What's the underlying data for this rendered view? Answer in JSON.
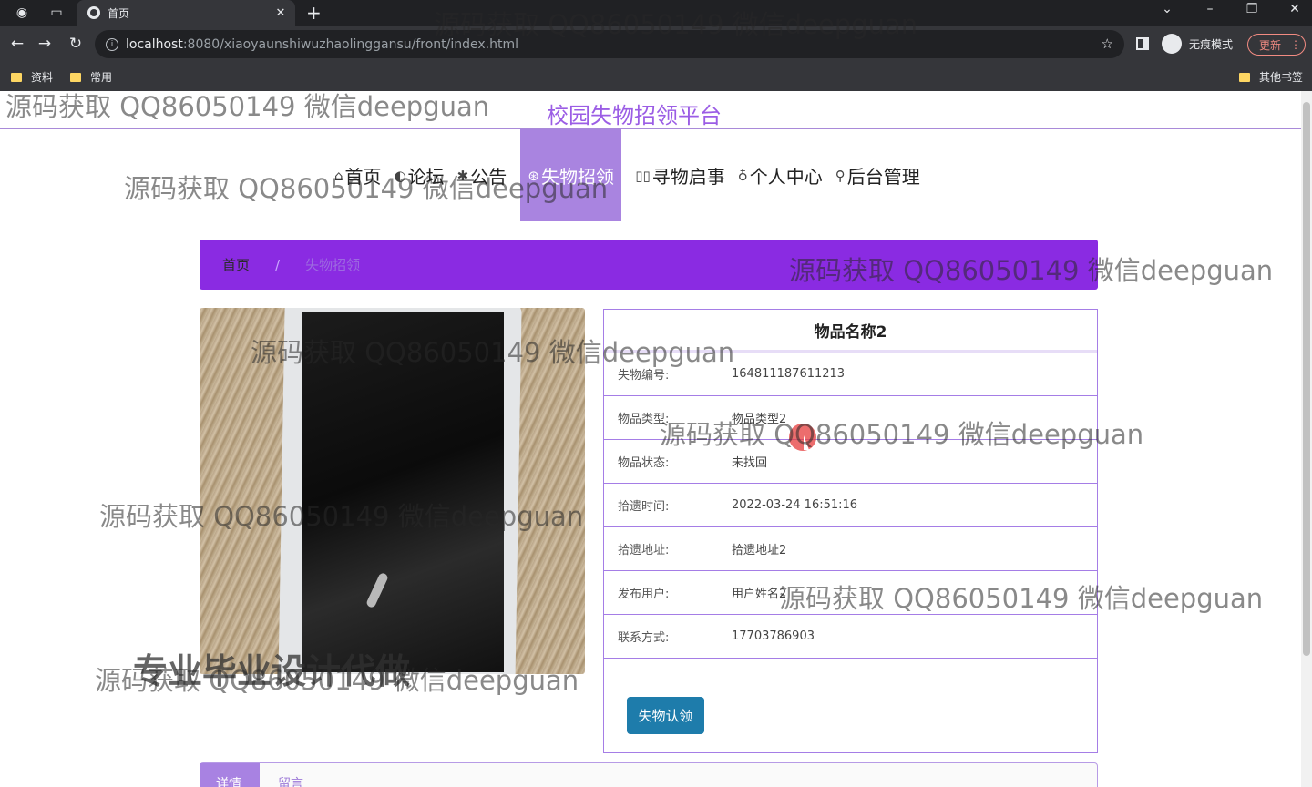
{
  "browser": {
    "tab_title": "首页",
    "url_host": "localhost",
    "url_path": ":8080/xiaoyaunshiwuzhaolinggansu/front/index.html",
    "incognito_label": "无痕模式",
    "update_label": "更新",
    "bookmarks": [
      "资料",
      "常用"
    ],
    "other_bookmarks": "其他书签"
  },
  "site": {
    "title": "校园失物招领平台"
  },
  "nav": [
    {
      "icon": "⌂",
      "label": "首页"
    },
    {
      "icon": "◐",
      "label": "论坛"
    },
    {
      "icon": "✱",
      "label": "公告"
    },
    {
      "icon": "⊛",
      "label": "失物招领"
    },
    {
      "icon": "▯▯",
      "label": "寻物启事"
    },
    {
      "icon": "♁",
      "label": "个人中心"
    },
    {
      "icon": "⚲",
      "label": "后台管理"
    }
  ],
  "breadcrumb": {
    "home": "首页",
    "separator": "/",
    "current": "失物招领"
  },
  "item": {
    "name": "物品名称2",
    "fields": [
      {
        "key": "失物编号:",
        "value": "164811187611213"
      },
      {
        "key": "物品类型:",
        "value": "物品类型2"
      },
      {
        "key": "物品状态:",
        "value": "未找回"
      },
      {
        "key": "拾遗时间:",
        "value": "2022-03-24 16:51:16"
      },
      {
        "key": "拾遗地址:",
        "value": "拾遗地址2"
      },
      {
        "key": "发布用户:",
        "value": "用户姓名2"
      },
      {
        "key": "联系方式:",
        "value": "17703786903"
      }
    ],
    "claim_button": "失物认领"
  },
  "tabs": {
    "detail": "详情",
    "message": "留言"
  },
  "watermarks": {
    "text": "源码获取 QQ86050149 微信deepguan",
    "big": "专业毕业设计代做"
  }
}
